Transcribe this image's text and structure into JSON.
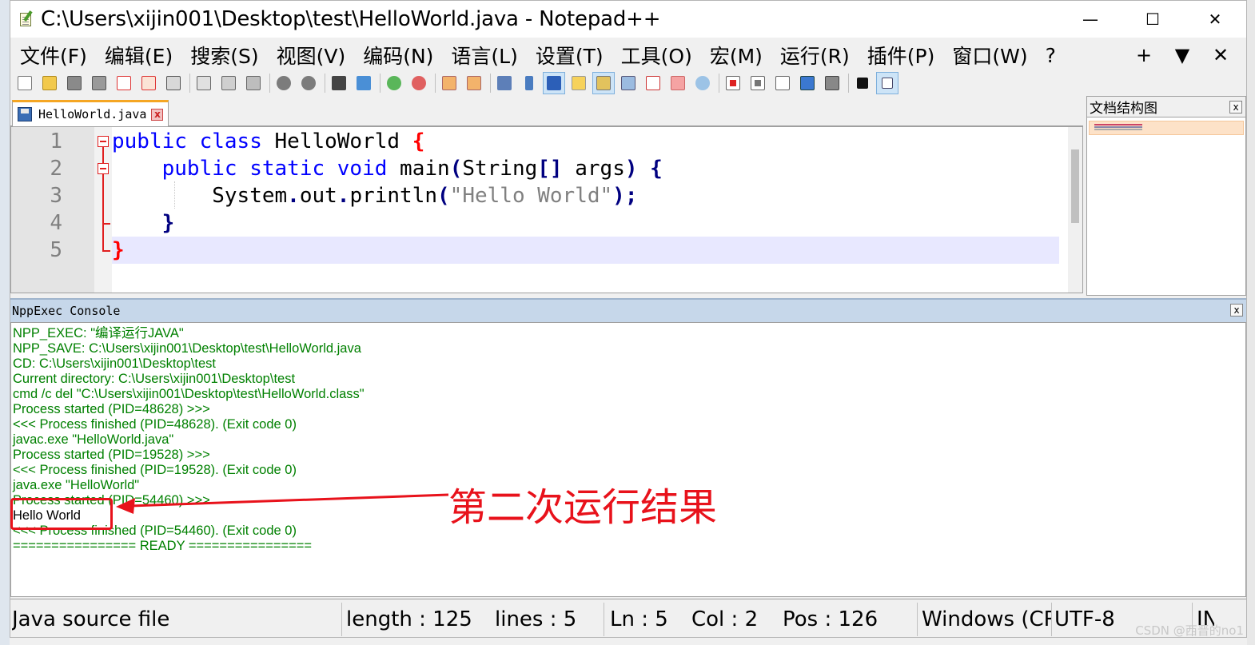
{
  "window": {
    "title": "C:\\Users\\xijin001\\Desktop\\test\\HelloWorld.java - Notepad++",
    "minimize": "—",
    "maximize": "☐",
    "close": "✕"
  },
  "menu": {
    "items": [
      "文件(F)",
      "编辑(E)",
      "搜索(S)",
      "视图(V)",
      "编码(N)",
      "语言(L)",
      "设置(T)",
      "工具(O)",
      "宏(M)",
      "运行(R)",
      "插件(P)",
      "窗口(W)",
      "?"
    ],
    "right": [
      "+",
      "▼",
      "✕"
    ]
  },
  "tab": {
    "label": "HelloWorld.java",
    "close": "x"
  },
  "editor": {
    "line_numbers": [
      "1",
      "2",
      "3",
      "4",
      "5"
    ],
    "lines": [
      {
        "indent": "",
        "tokens": [
          {
            "t": "public",
            "c": "kw"
          },
          {
            "t": " ",
            "c": "id"
          },
          {
            "t": "class",
            "c": "kw"
          },
          {
            "t": " HelloWorld ",
            "c": "id"
          },
          {
            "t": "{",
            "c": "br2"
          }
        ]
      },
      {
        "indent": "    ",
        "tokens": [
          {
            "t": "public",
            "c": "kw"
          },
          {
            "t": " ",
            "c": "id"
          },
          {
            "t": "static",
            "c": "kw"
          },
          {
            "t": " ",
            "c": "id"
          },
          {
            "t": "void",
            "c": "kw"
          },
          {
            "t": " main",
            "c": "id"
          },
          {
            "t": "(",
            "c": "br"
          },
          {
            "t": "String",
            "c": "id"
          },
          {
            "t": "[]",
            "c": "br"
          },
          {
            "t": " args",
            "c": "id"
          },
          {
            "t": ")",
            "c": "br"
          },
          {
            "t": " ",
            "c": "id"
          },
          {
            "t": "{",
            "c": "br"
          }
        ]
      },
      {
        "indent": "        ",
        "tokens": [
          {
            "t": "System",
            "c": "id"
          },
          {
            "t": ".",
            "c": "br"
          },
          {
            "t": "out",
            "c": "id"
          },
          {
            "t": ".",
            "c": "br"
          },
          {
            "t": "println",
            "c": "id"
          },
          {
            "t": "(",
            "c": "br"
          },
          {
            "t": "\"Hello World\"",
            "c": "str"
          },
          {
            "t": ");",
            "c": "br"
          }
        ]
      },
      {
        "indent": "    ",
        "tokens": [
          {
            "t": "}",
            "c": "br"
          }
        ]
      },
      {
        "indent": "",
        "tokens": [
          {
            "t": "}",
            "c": "br2"
          }
        ]
      }
    ]
  },
  "docmap": {
    "title": "文档结构图",
    "close": "x"
  },
  "console": {
    "title": "NppExec Console",
    "close": "x",
    "lines": [
      "NPP_EXEC: \"编译运行JAVA\"",
      "NPP_SAVE: C:\\Users\\xijin001\\Desktop\\test\\HelloWorld.java",
      "CD: C:\\Users\\xijin001\\Desktop\\test",
      "Current directory: C:\\Users\\xijin001\\Desktop\\test",
      "cmd /c del \"C:\\Users\\xijin001\\Desktop\\test\\HelloWorld.class\"",
      "Process started (PID=48628) >>>",
      "<<< Process finished (PID=48628). (Exit code 0)",
      "javac.exe \"HelloWorld.java\"",
      "Process started (PID=19528) >>>",
      "<<< Process finished (PID=19528). (Exit code 0)",
      "java.exe \"HelloWorld\"",
      "Process started (PID=54460) >>>",
      "Hello World",
      "<<< Process finished (PID=54460). (Exit code 0)",
      "================ READY ================"
    ],
    "output_line_index": 12
  },
  "annotation": {
    "text": "第二次运行结果",
    "color": "#e8121b"
  },
  "statusbar": {
    "filetype": "Java source file",
    "length": "length : 125",
    "lines": "lines : 5",
    "ln": "Ln : 5",
    "col": "Col : 2",
    "pos": "Pos : 126",
    "eol": "Windows (CR LF)",
    "encoding": "UTF-8",
    "mode": "INS"
  },
  "watermark": "CSDN @西晋的no1"
}
